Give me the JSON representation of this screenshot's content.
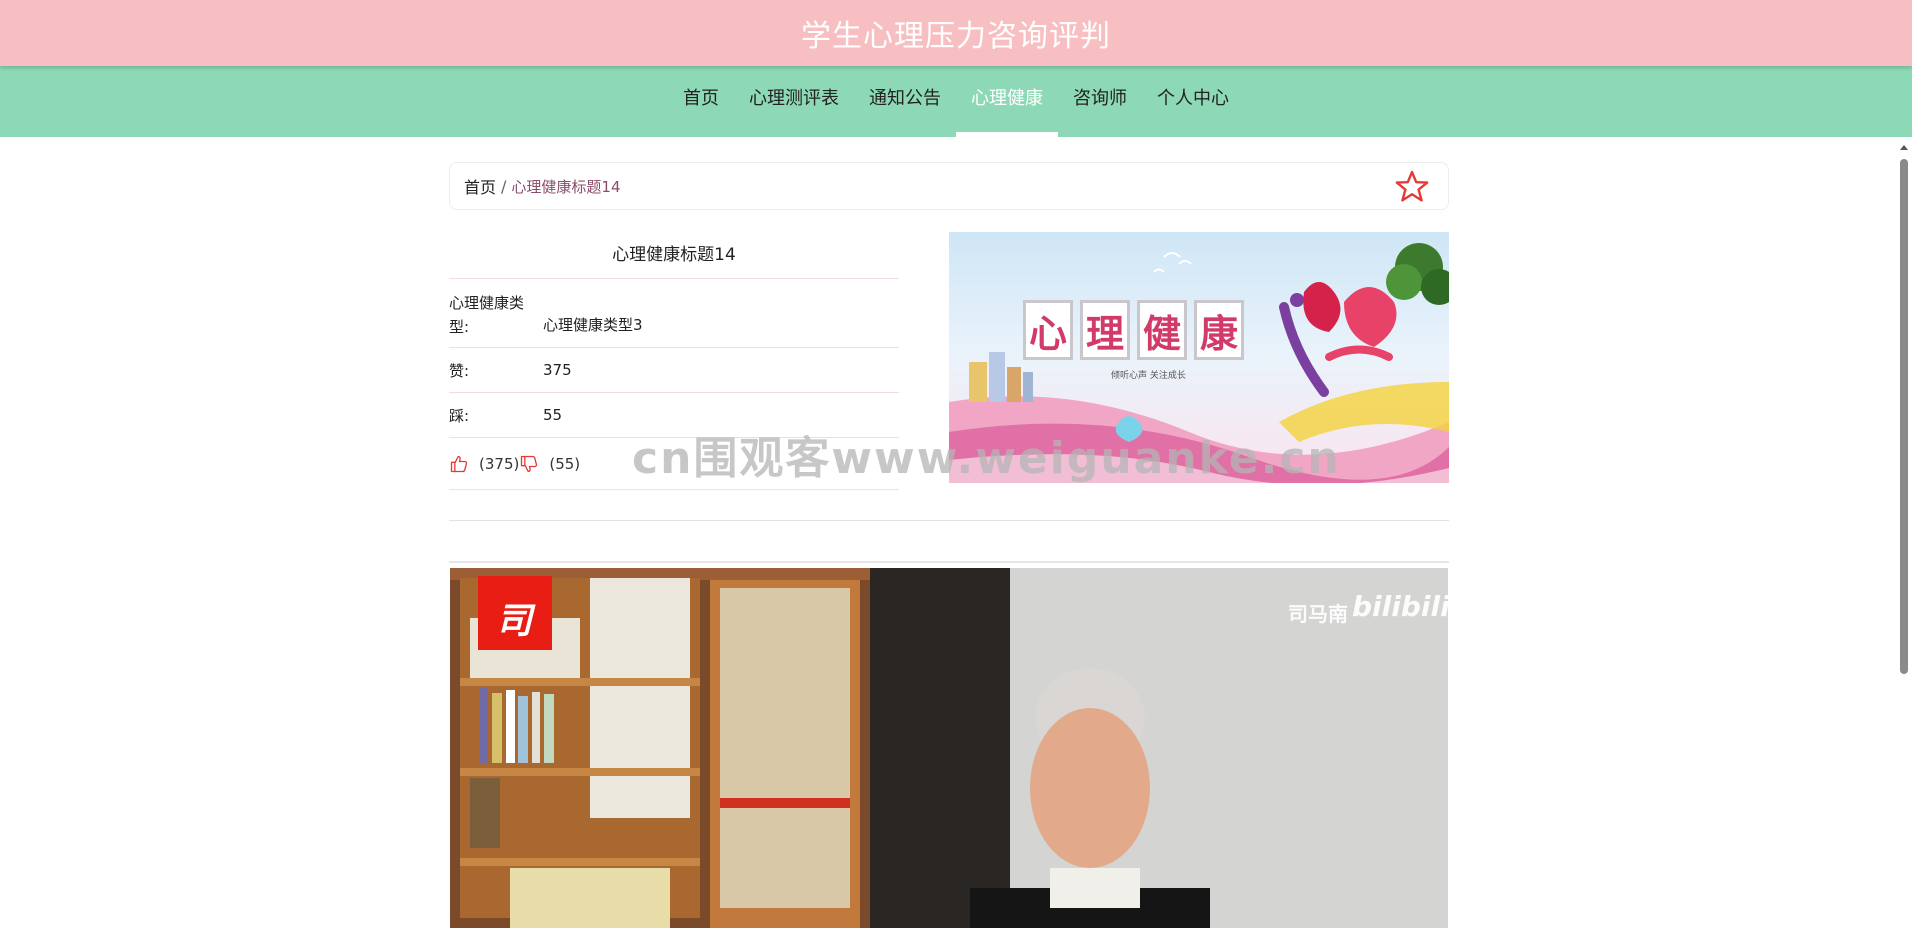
{
  "header": {
    "site_title": "学生心理压力咨询评判"
  },
  "nav": {
    "items": [
      {
        "label": "首页"
      },
      {
        "label": "心理测评表"
      },
      {
        "label": "通知公告"
      },
      {
        "label": "心理健康"
      },
      {
        "label": "咨询师"
      },
      {
        "label": "个人中心"
      }
    ],
    "active_item": "心理健康"
  },
  "breadcrumb": {
    "home": "首页",
    "separator": "/",
    "current": "心理健康标题14"
  },
  "favorite": {
    "icon": "star-outline-icon",
    "color": "#e53935"
  },
  "detail": {
    "title": "心理健康标题14",
    "fields": [
      {
        "label": "心理健康类型:",
        "value": "心理健康类型3"
      },
      {
        "label": "赞:",
        "value": "375"
      },
      {
        "label": "踩:",
        "value": "55"
      }
    ],
    "like_count": "(375)",
    "dislike_count": "(55)",
    "like_icon": "thumbs-up-icon",
    "dislike_icon": "thumbs-down-icon",
    "accent_color": "#e53935"
  },
  "cover": {
    "characters": [
      "心",
      "理",
      "健",
      "康"
    ],
    "subtitle": "倾听心声 关注成长"
  },
  "video": {
    "channel_badge": "司",
    "channel_name": "司马南",
    "platform_logo": "bilibili"
  },
  "watermark": "cn围观客www.weiguanke.cn"
}
